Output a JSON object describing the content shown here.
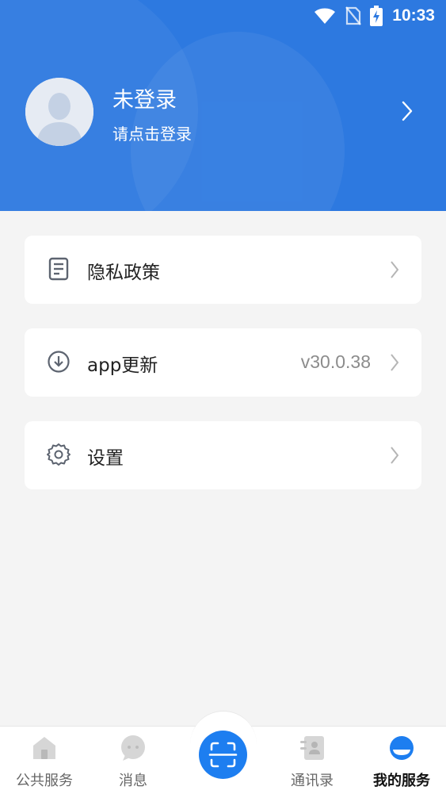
{
  "status_bar": {
    "time": "10:33",
    "icons": [
      "wifi-icon",
      "no-sim-icon",
      "battery-charging-icon"
    ]
  },
  "profile": {
    "name": "未登录",
    "subtitle": "请点击登录",
    "avatar_icon": "default-avatar-icon"
  },
  "menu": [
    {
      "label": "隐私政策",
      "value": "",
      "icon": "document-icon"
    },
    {
      "label": "app更新",
      "value": "v30.0.38",
      "icon": "download-circle-icon"
    },
    {
      "label": "设置",
      "value": "",
      "icon": "gear-icon"
    }
  ],
  "tabbar": {
    "tabs": [
      {
        "label": "公共服务",
        "icon": "home-icon",
        "active": false
      },
      {
        "label": "消息",
        "icon": "chat-icon",
        "active": false
      },
      {
        "label": "",
        "icon": "scan-icon",
        "active": false
      },
      {
        "label": "通讯录",
        "icon": "contacts-icon",
        "active": false
      },
      {
        "label": "我的服务",
        "icon": "profile-tab-icon",
        "active": true
      }
    ]
  },
  "colors": {
    "primary": "#2d79e0",
    "scan_button": "#1d7ef0",
    "background": "#f4f4f4"
  }
}
